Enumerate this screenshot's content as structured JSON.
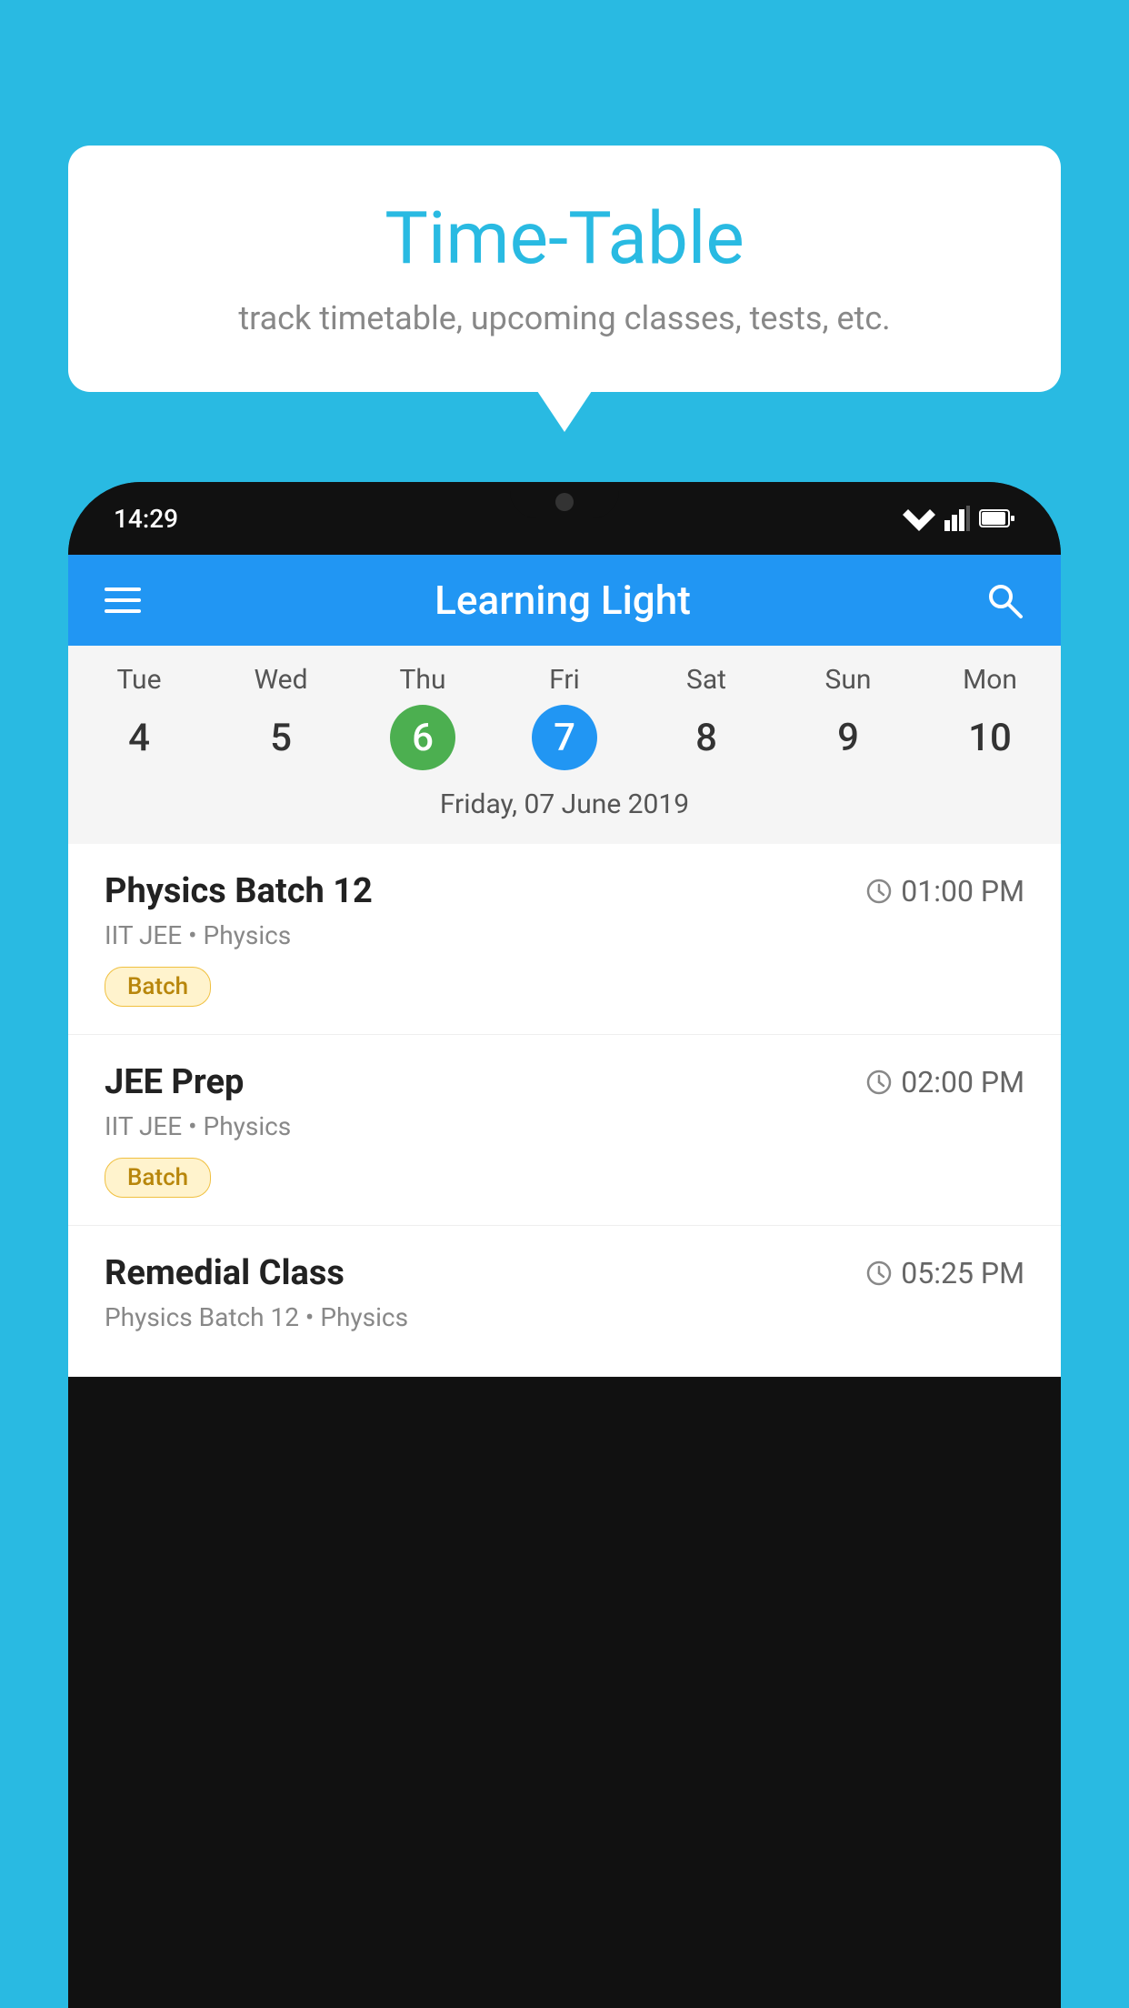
{
  "background_color": "#29BAE2",
  "speech_bubble": {
    "title": "Time-Table",
    "subtitle": "track timetable, upcoming classes, tests, etc."
  },
  "phone": {
    "status_bar": {
      "time": "14:29"
    },
    "app_bar": {
      "title": "Learning Light",
      "menu_label": "Menu",
      "search_label": "Search"
    },
    "calendar": {
      "days": [
        {
          "label": "Tue",
          "num": "4"
        },
        {
          "label": "Wed",
          "num": "5"
        },
        {
          "label": "Thu",
          "num": "6",
          "state": "today"
        },
        {
          "label": "Fri",
          "num": "7",
          "state": "selected"
        },
        {
          "label": "Sat",
          "num": "8"
        },
        {
          "label": "Sun",
          "num": "9"
        },
        {
          "label": "Mon",
          "num": "10"
        }
      ],
      "selected_date": "Friday, 07 June 2019"
    },
    "schedule": [
      {
        "title": "Physics Batch 12",
        "time": "01:00 PM",
        "subtitle": "IIT JEE • Physics",
        "tag": "Batch"
      },
      {
        "title": "JEE Prep",
        "time": "02:00 PM",
        "subtitle": "IIT JEE • Physics",
        "tag": "Batch"
      },
      {
        "title": "Remedial Class",
        "time": "05:25 PM",
        "subtitle": "Physics Batch 12 • Physics",
        "tag": ""
      }
    ]
  }
}
